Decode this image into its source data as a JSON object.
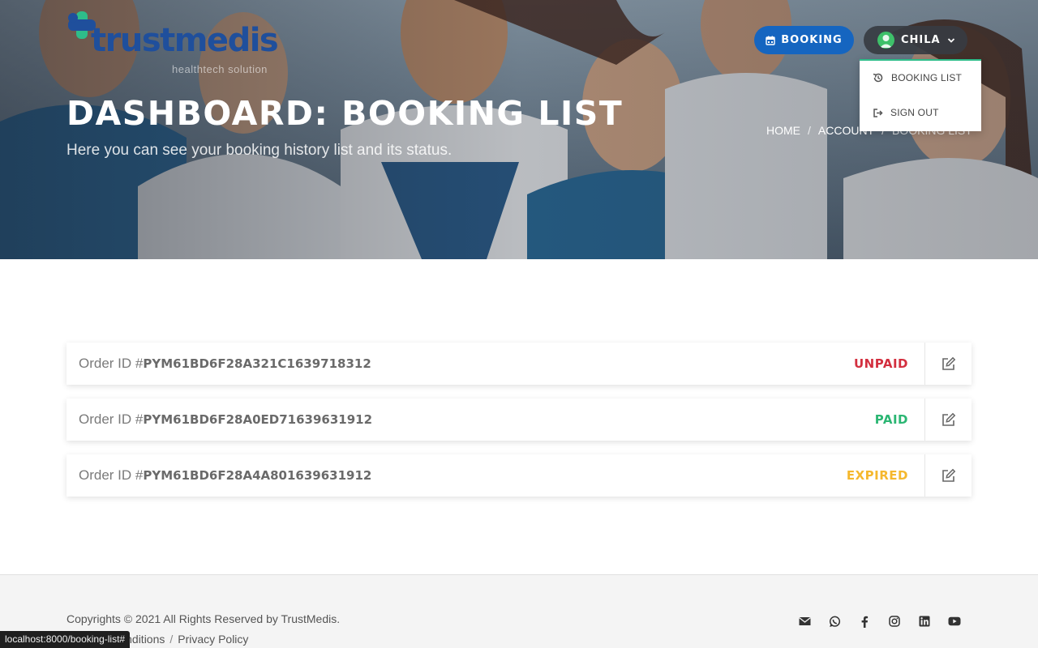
{
  "brand": {
    "name": "trustmedis",
    "tagline": "healthtech solution"
  },
  "header": {
    "booking_label": "BOOKING",
    "user_name": "CHILA"
  },
  "user_menu": {
    "items": [
      {
        "label": "BOOKING LIST",
        "icon": "history-icon"
      },
      {
        "label": "SIGN OUT",
        "icon": "sign-out-icon"
      }
    ]
  },
  "hero": {
    "title": "DASHBOARD: BOOKING LIST",
    "subtitle": "Here you can see your booking history list and its status."
  },
  "breadcrumb": {
    "items": [
      "HOME",
      "ACCOUNT",
      "BOOKING LIST"
    ],
    "separator": "/"
  },
  "orders": {
    "prefix": "Order ID #",
    "items": [
      {
        "id": "PYM61BD6F28A321C1639718312",
        "status": "UNPAID",
        "status_color": "#d32f3f"
      },
      {
        "id": "PYM61BD6F28A0ED71639631912",
        "status": "PAID",
        "status_color": "#2bb673"
      },
      {
        "id": "PYM61BD6F28A4A801639631912",
        "status": "EXPIRED",
        "status_color": "#f5b82e"
      }
    ]
  },
  "footer": {
    "copyright": "Copyrights © 2021 All Rights Reserved by TrustMedis.",
    "links": [
      "Terms & Conditions",
      "Privacy Policy"
    ],
    "socials": [
      "email-icon",
      "whatsapp-icon",
      "facebook-icon",
      "instagram-icon",
      "linkedin-icon",
      "youtube-icon"
    ]
  },
  "status_bar": {
    "url": "localhost:8000/booking-list#"
  },
  "colors": {
    "primary": "#1565c0",
    "accent": "#2ebd8a",
    "unpaid": "#d32f3f",
    "paid": "#2bb673",
    "expired": "#f5b82e"
  }
}
